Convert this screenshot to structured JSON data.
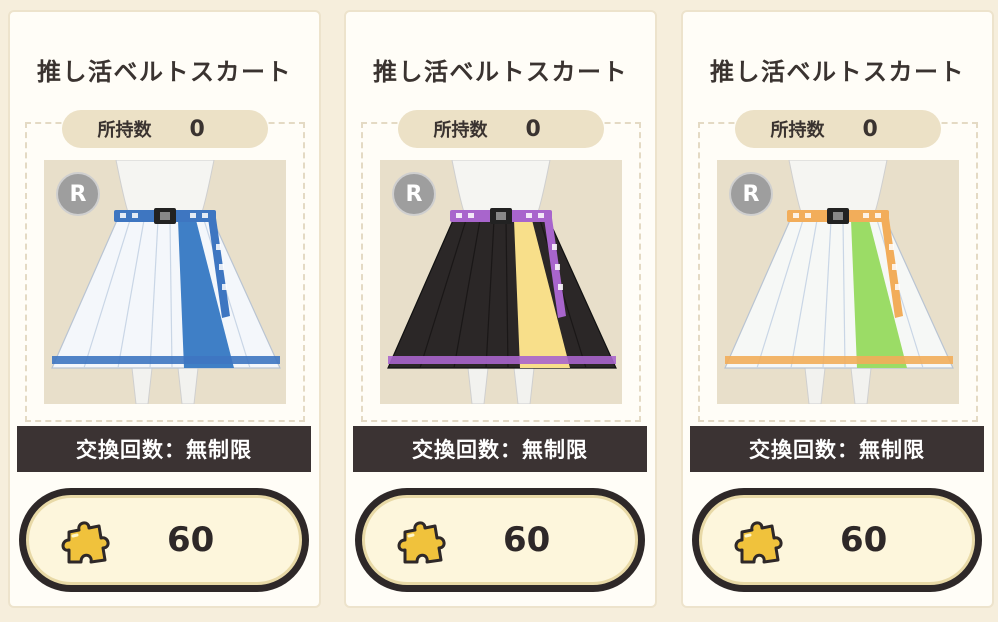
{
  "items": [
    {
      "title": "推し活ベルトスカート",
      "owned_label": "所持数",
      "owned_count": "0",
      "rarity": "R",
      "exchange_limit": "交換回数：無制限",
      "price": "60",
      "price_icon": "puzzle-piece-icon",
      "colors": {
        "main": "#f4f7fb",
        "accent": "#3f7fc6",
        "belt": "#3e76c1"
      }
    },
    {
      "title": "推し活ベルトスカート",
      "owned_label": "所持数",
      "owned_count": "0",
      "rarity": "R",
      "exchange_limit": "交換回数：無制限",
      "price": "60",
      "price_icon": "puzzle-piece-icon",
      "colors": {
        "main": "#2b2727",
        "accent": "#f8df8a",
        "belt": "#a865cc"
      }
    },
    {
      "title": "推し活ベルトスカート",
      "owned_label": "所持数",
      "owned_count": "0",
      "rarity": "R",
      "exchange_limit": "交換回数：無制限",
      "price": "60",
      "price_icon": "puzzle-piece-icon",
      "colors": {
        "main": "#f6f8f6",
        "accent": "#9bdc66",
        "belt": "#f2ad5a"
      }
    }
  ]
}
